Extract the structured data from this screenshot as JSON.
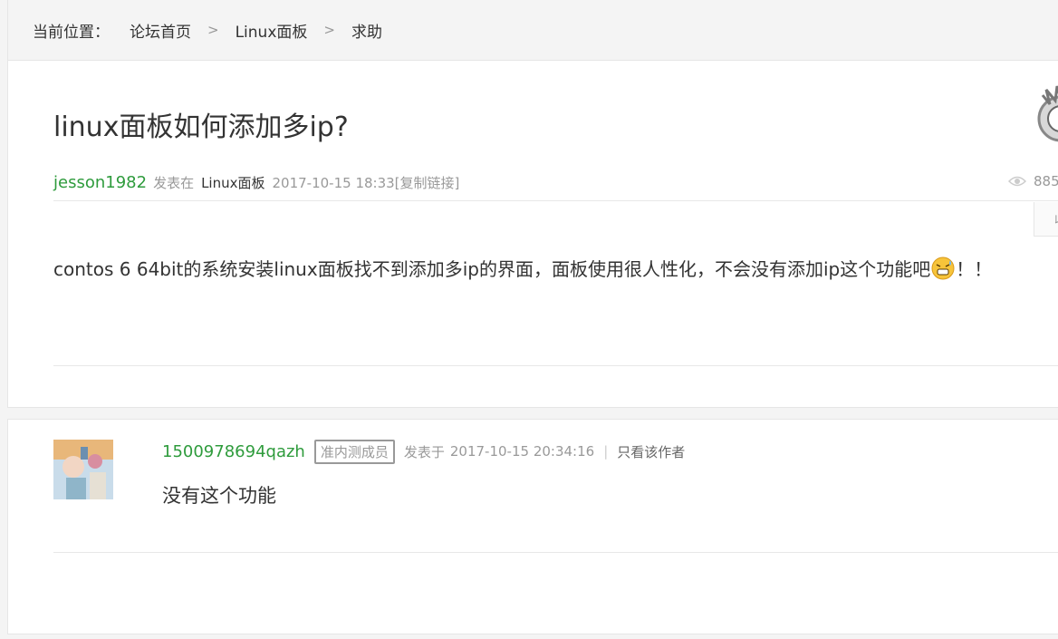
{
  "breadcrumb": {
    "label": "当前位置：",
    "items": [
      "论坛首页",
      "Linux面板",
      "求助"
    ],
    "separator": ">"
  },
  "post": {
    "title": "linux面板如何添加多ip?",
    "author": "jesson1982",
    "posted_in": "发表在",
    "board": "Linux面板",
    "timestamp": "2017-10-15 18:33",
    "copy_link": "[复制链接]",
    "views": "885",
    "fav_button": "收",
    "body_before_emoji": "contos 6 64bit的系统安装linux面板找不到添加多ip的界面，面板使用很人性化，不会没有添加ip这个功能吧",
    "body_after_emoji": "！！",
    "emoji_icon": "sweat-face-icon"
  },
  "reply": {
    "author": "1500978694qazh",
    "badge": "准内测成员",
    "posted_at_label": "发表于",
    "timestamp": "2017-10-15 20:34:16",
    "pipe": "|",
    "only_author": "只看该作者",
    "text": "没有这个功能"
  },
  "colors": {
    "author_green": "#2e9b3c",
    "meta_gray": "#999999",
    "background": "#f4f4f4"
  }
}
